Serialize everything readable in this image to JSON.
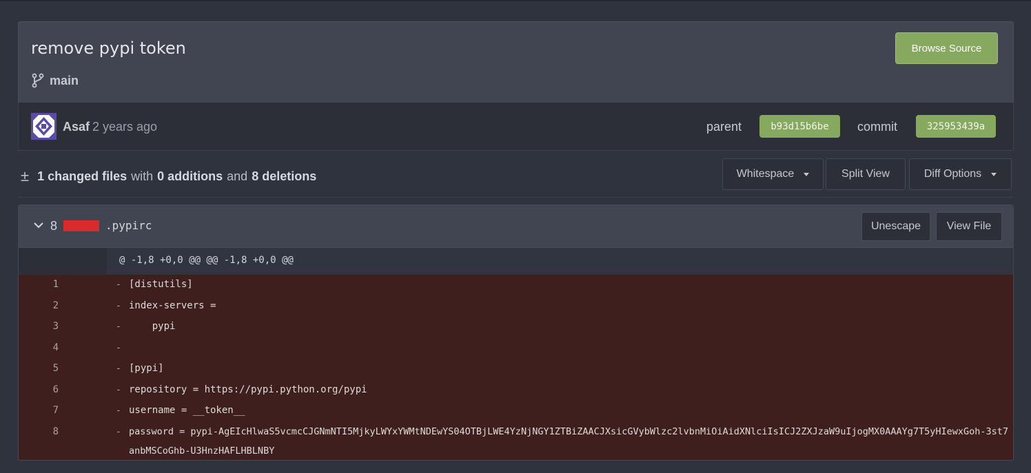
{
  "commit": {
    "title": "remove pypi token",
    "branch": "main",
    "browse_button": "Browse Source",
    "author": "Asaf",
    "time": "2 years ago",
    "parent_label": "parent",
    "parent_sha": "b93d15b6be",
    "commit_label": "commit",
    "commit_sha": "325953439a"
  },
  "stats": {
    "changed": "1 changed files",
    "with": "with",
    "additions": "0 additions",
    "and": "and",
    "deletions": "8 deletions"
  },
  "toolbar": {
    "whitespace": "Whitespace",
    "split_view": "Split View",
    "diff_options": "Diff Options"
  },
  "file": {
    "deletions_count": "8",
    "name": ".pypirc",
    "unescape": "Unescape",
    "view_file": "View File",
    "hunk_header": "@ -1,8 +0,0 @@ @@ -1,8 +0,0 @@",
    "lines": [
      {
        "num": "1",
        "sign": "-",
        "code": "[distutils]"
      },
      {
        "num": "2",
        "sign": "-",
        "code": "index-servers ="
      },
      {
        "num": "3",
        "sign": "-",
        "code": "    pypi"
      },
      {
        "num": "4",
        "sign": "-",
        "code": ""
      },
      {
        "num": "5",
        "sign": "-",
        "code": "[pypi]"
      },
      {
        "num": "6",
        "sign": "-",
        "code": "repository = https://pypi.python.org/pypi"
      },
      {
        "num": "7",
        "sign": "-",
        "code": "username = __token__"
      },
      {
        "num": "8",
        "sign": "-",
        "code": "password = pypi-AgEIcHlwaS5vcmcCJGNmNTI5MjkyLWYxYWMtNDEwYS04OTBjLWE4YzNjNGY1ZTBiZAACJXsicGVybWlzc2lvbnMiOiAidXNlciIsICJ2ZXJzaW9uIjogMX0AAAYg7T5yHIewxGoh-3st7anbMSCoGhb-U3HnzHAFLHBLNBY"
      }
    ]
  },
  "colors": {
    "accent_green": "#86a95f",
    "deleted_line_bg": "#3f1e1e",
    "deletion_bar": "#d92b2b"
  }
}
